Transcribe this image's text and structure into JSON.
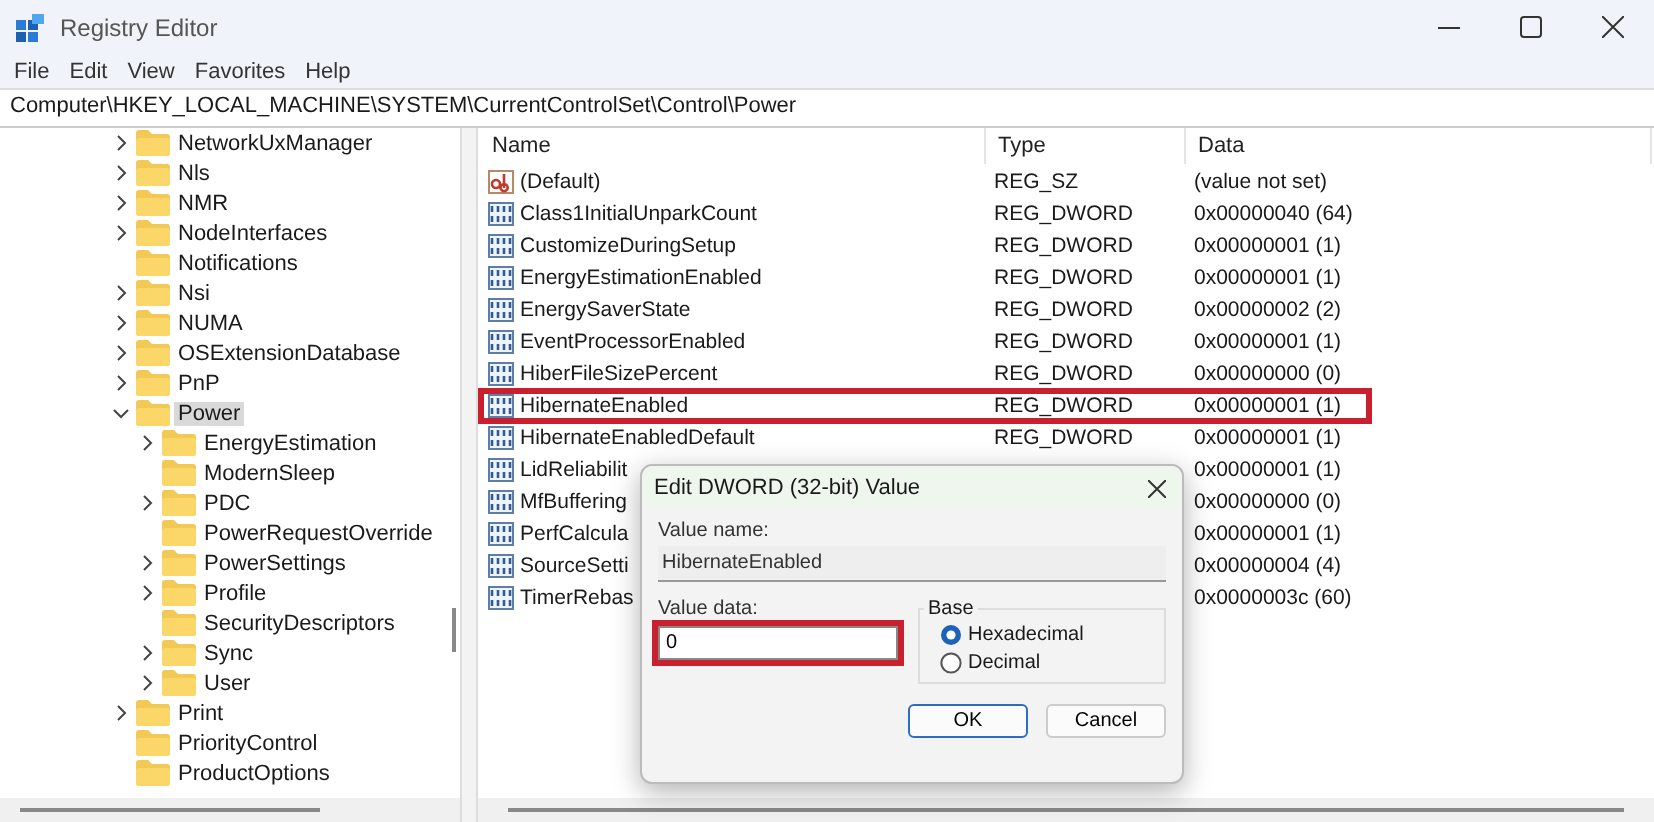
{
  "window": {
    "title": "Registry Editor"
  },
  "menu": [
    "File",
    "Edit",
    "View",
    "Favorites",
    "Help"
  ],
  "address_bar": "Computer\\HKEY_LOCAL_MACHINE\\SYSTEM\\CurrentControlSet\\Control\\Power",
  "tree": {
    "items": [
      {
        "label": "NetworkUxManager",
        "has_children": true,
        "expanded": false,
        "selected": false
      },
      {
        "label": "Nls",
        "has_children": true,
        "expanded": false,
        "selected": false
      },
      {
        "label": "NMR",
        "has_children": true,
        "expanded": false,
        "selected": false
      },
      {
        "label": "NodeInterfaces",
        "has_children": true,
        "expanded": false,
        "selected": false
      },
      {
        "label": "Notifications",
        "has_children": false,
        "selected": false
      },
      {
        "label": "Nsi",
        "has_children": true,
        "expanded": false,
        "selected": false
      },
      {
        "label": "NUMA",
        "has_children": true,
        "expanded": false,
        "selected": false
      },
      {
        "label": "OSExtensionDatabase",
        "has_children": true,
        "expanded": false,
        "selected": false
      },
      {
        "label": "PnP",
        "has_children": true,
        "expanded": false,
        "selected": false
      },
      {
        "label": "Power",
        "has_children": true,
        "expanded": true,
        "selected": true,
        "children": [
          {
            "label": "EnergyEstimation",
            "has_children": true,
            "expanded": false,
            "selected": false
          },
          {
            "label": "ModernSleep",
            "has_children": false,
            "selected": false
          },
          {
            "label": "PDC",
            "has_children": true,
            "expanded": false,
            "selected": false
          },
          {
            "label": "PowerRequestOverride",
            "has_children": false,
            "selected": false
          },
          {
            "label": "PowerSettings",
            "has_children": true,
            "expanded": false,
            "selected": false
          },
          {
            "label": "Profile",
            "has_children": true,
            "expanded": false,
            "selected": false
          },
          {
            "label": "SecurityDescriptors",
            "has_children": false,
            "selected": false
          },
          {
            "label": "Sync",
            "has_children": true,
            "expanded": false,
            "selected": false
          },
          {
            "label": "User",
            "has_children": true,
            "expanded": false,
            "selected": false
          }
        ]
      },
      {
        "label": "Print",
        "has_children": true,
        "expanded": false,
        "selected": false
      },
      {
        "label": "PriorityControl",
        "has_children": false,
        "selected": false
      },
      {
        "label": "ProductOptions",
        "has_children": false,
        "selected": false
      }
    ]
  },
  "list": {
    "columns": [
      "Name",
      "Type",
      "Data"
    ],
    "rows": [
      {
        "kind": "string",
        "name": "(Default)",
        "type": "REG_SZ",
        "data": "(value not set)",
        "highlighted": false
      },
      {
        "kind": "dword",
        "name": "Class1InitialUnparkCount",
        "type": "REG_DWORD",
        "data": "0x00000040 (64)",
        "highlighted": false
      },
      {
        "kind": "dword",
        "name": "CustomizeDuringSetup",
        "type": "REG_DWORD",
        "data": "0x00000001 (1)",
        "highlighted": false
      },
      {
        "kind": "dword",
        "name": "EnergyEstimationEnabled",
        "type": "REG_DWORD",
        "data": "0x00000001 (1)",
        "highlighted": false
      },
      {
        "kind": "dword",
        "name": "EnergySaverState",
        "type": "REG_DWORD",
        "data": "0x00000002 (2)",
        "highlighted": false
      },
      {
        "kind": "dword",
        "name": "EventProcessorEnabled",
        "type": "REG_DWORD",
        "data": "0x00000001 (1)",
        "highlighted": false
      },
      {
        "kind": "dword",
        "name": "HiberFileSizePercent",
        "type": "REG_DWORD",
        "data": "0x00000000 (0)",
        "highlighted": false
      },
      {
        "kind": "dword",
        "name": "HibernateEnabled",
        "type": "REG_DWORD",
        "data": "0x00000001 (1)",
        "highlighted": true
      },
      {
        "kind": "dword",
        "name": "HibernateEnabledDefault",
        "type": "REG_DWORD",
        "data": "0x00000001 (1)",
        "highlighted": false
      },
      {
        "kind": "dword",
        "name": "LidReliabilit",
        "data": "0x00000001 (1)",
        "highlighted": false
      },
      {
        "kind": "dword",
        "name": "MfBuffering",
        "data": "0x00000000 (0)",
        "highlighted": false
      },
      {
        "kind": "dword",
        "name": "PerfCalcula",
        "data": "0x00000001 (1)",
        "highlighted": false
      },
      {
        "kind": "dword",
        "name": "SourceSetti",
        "data": "0x00000004 (4)",
        "highlighted": false
      },
      {
        "kind": "dword",
        "name": "TimerRebas",
        "data": "0x0000003c (60)",
        "highlighted": false
      }
    ]
  },
  "dialog": {
    "title": "Edit DWORD (32-bit) Value",
    "value_name_label": "Value name:",
    "value_name": "HibernateEnabled",
    "value_data_label": "Value data:",
    "value_data": "0",
    "value_data_highlighted": true,
    "base_label": "Base",
    "base_options": [
      {
        "label": "Hexadecimal",
        "selected": true
      },
      {
        "label": "Decimal",
        "selected": false
      }
    ],
    "buttons": [
      {
        "label": "OK",
        "default": true
      },
      {
        "label": "Cancel",
        "default": false
      }
    ]
  }
}
